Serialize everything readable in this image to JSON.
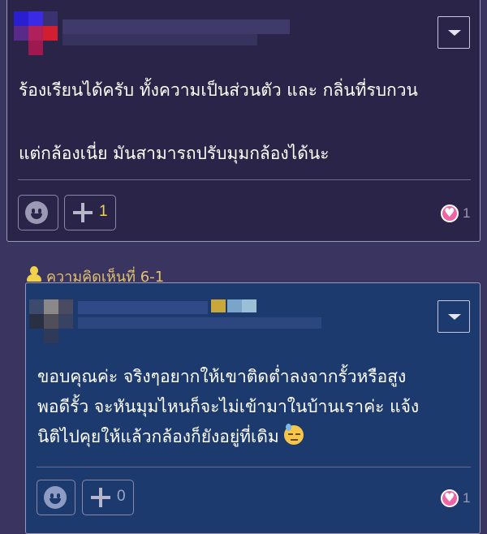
{
  "comment": {
    "body_line1": "ร้องเรียนได้ครับ ทั้งความเป็นส่วนตัว และ กลิ่นที่รบกวน",
    "body_line2": "แต่กล้องเนี่ย มันสามารถปรับมุมกล้องได้นะ",
    "plus_count": "1",
    "like_count": "1"
  },
  "reply": {
    "label": "ความคิดเห็นที่ 6-1",
    "body_line1": "ขอบคุณค่ะ จริงๆอยากให้เขาติดต่ำลงจากรั้วหรือสูง",
    "body_line2": "พอดีรั้ว จะหันมุมไหนก็จะไม่เข้ามาในบ้านเราค่ะ แจ้ง",
    "body_line3": "นิติไปคุยให้แล้วกล้องก็ยังอยู่ที่เดิม",
    "plus_count": "0",
    "like_count": "1"
  },
  "colors": {
    "page_bg": "#3a3560",
    "comment_card_bg": "#2a2548",
    "reply_card_bg": "#1d3a6e",
    "plus_count_active": "#f2d24a",
    "reply_label": "#e2c26a",
    "like_icon": "#f064a6"
  },
  "icons": [
    "dropdown-icon",
    "smile-icon",
    "plus-icon",
    "heart-icon",
    "user-icon",
    "sweat-emoji-icon"
  ]
}
